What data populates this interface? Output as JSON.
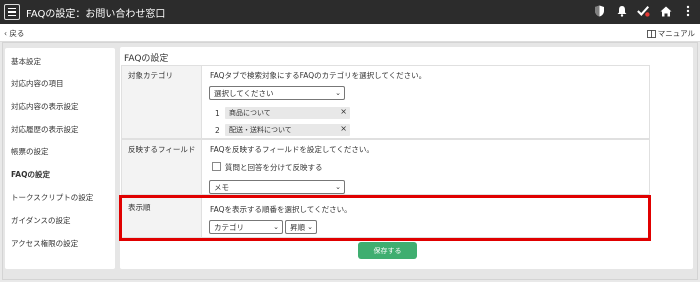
{
  "header": {
    "title": "FAQの設定：お問い合わせ窓口",
    "icons": [
      "shield-icon",
      "bell-icon",
      "check-icon",
      "home-icon",
      "more-icon"
    ]
  },
  "subbar": {
    "back_label": "戻る",
    "manual_label": "マニュアル"
  },
  "sidebar": {
    "items": [
      {
        "label": "基本設定"
      },
      {
        "label": "対応内容の項目"
      },
      {
        "label": "対応内容の表示設定"
      },
      {
        "label": "対応履歴の表示設定"
      },
      {
        "label": "帳票の設定"
      },
      {
        "label": "FAQの設定"
      },
      {
        "label": "トークスクリプトの設定"
      },
      {
        "label": "ガイダンスの設定"
      },
      {
        "label": "アクセス権限の設定"
      }
    ]
  },
  "main": {
    "title": "FAQの設定",
    "rows": {
      "category": {
        "label": "対象カテゴリ",
        "description": "FAQタブで検索対象にするFAQのカテゴリを選択してください。",
        "select_value": "選択してください",
        "tags": [
          {
            "num": "1",
            "text": "商品について"
          },
          {
            "num": "2",
            "text": "配送・送料について"
          }
        ]
      },
      "field": {
        "label": "反映するフィールド",
        "description": "FAQを反映するフィールドを設定してください。",
        "checkbox_label": "質問と回答を分けて反映する",
        "select_value": "メモ"
      },
      "order": {
        "label": "表示順",
        "description": "FAQを表示する順番を選択してください。",
        "sort_field": "カテゴリ",
        "sort_dir": "昇順"
      }
    },
    "save_label": "保存する"
  },
  "colors": {
    "header_bg": "#2c2c2c",
    "save_button": "#3fae70",
    "highlight_frame": "#e00000"
  }
}
